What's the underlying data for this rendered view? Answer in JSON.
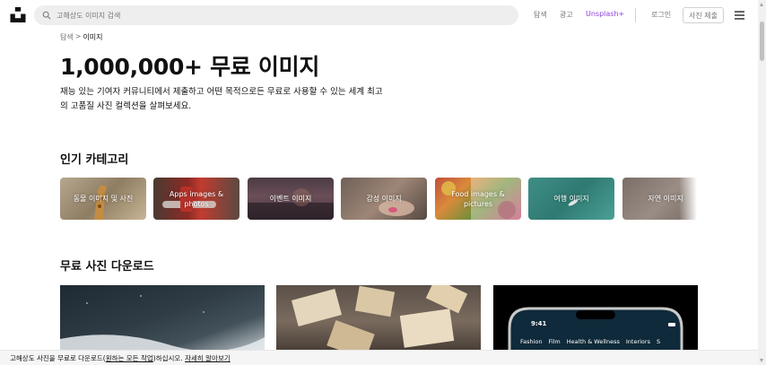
{
  "header": {
    "search_placeholder": "고해상도 이미지 검색",
    "nav": {
      "explore": "탐색",
      "advertise": "광고",
      "unsplash_plus": "Unsplash+",
      "login": "로그인",
      "submit_photo": "사진 제출"
    }
  },
  "breadcrumb": {
    "root": "탐색",
    "separator": ">",
    "current": "이미지"
  },
  "hero": {
    "title": "1,000,000+ 무료 이미지",
    "description": "재능 있는 기여자 커뮤니티에서 제출하고 어떤 목적으로든 무료로 사용할 수 있는 세계 최고의 고품질 사진 컬렉션을 살펴보세요."
  },
  "categories": {
    "title": "인기 카테고리",
    "items": [
      {
        "label": "동물 이미지 및 사진"
      },
      {
        "label": "Apps images & photos"
      },
      {
        "label": "이벤트 이미지"
      },
      {
        "label": "감성 이미지"
      },
      {
        "label": "Food images & pictures"
      },
      {
        "label": "여행 이미지"
      },
      {
        "label": "자연 이미지"
      }
    ]
  },
  "downloads": {
    "title": "무료 사진 다운로드",
    "phone_time": "9:41",
    "phone_tabs": [
      "Fashion",
      "Film",
      "Health & Wellness",
      "Interiors",
      "S"
    ]
  },
  "cookie": {
    "text_before": "고해상도 사진을 무료로 다운로드(",
    "link1": "원하는 모든 작업",
    "text_after": ")하십시오.",
    "link2": "자세히 알아보기"
  },
  "colors": {
    "unsplash_plus": "#8e3ed8",
    "muted_text": "#767676",
    "search_bg": "#eeeeee"
  },
  "icons": [
    "unsplash-logo-icon",
    "search-icon",
    "hamburger-menu-icon"
  ]
}
